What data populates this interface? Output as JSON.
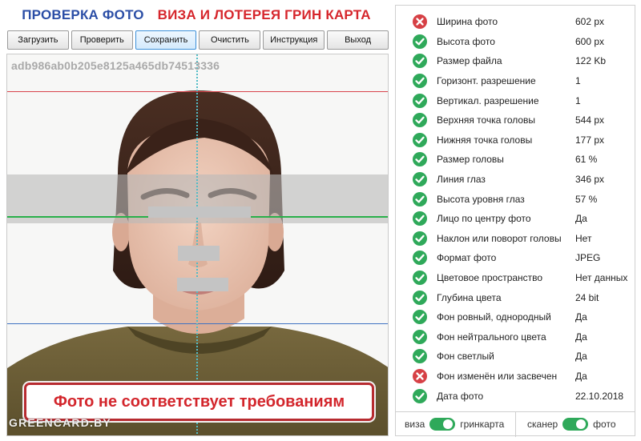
{
  "header": {
    "title_part1": "ПРОВЕРКА ФОТО",
    "title_part2": "ВИЗА И ЛОТЕРЕЯ ГРИН КАРТА"
  },
  "toolbar": {
    "buttons": [
      {
        "label": "Загрузить"
      },
      {
        "label": "Проверить"
      },
      {
        "label": "Сохранить"
      },
      {
        "label": "Очистить"
      },
      {
        "label": "Инструкция"
      },
      {
        "label": "Выход"
      }
    ]
  },
  "photo": {
    "hash": "adb986ab0b205e8125a465db74513336",
    "warning": "Фото не соответствует требованиям",
    "watermark": "GREENCARD.BY"
  },
  "checks": [
    {
      "label": "Ширина фото",
      "value": "602 px",
      "status": "fail"
    },
    {
      "label": "Высота фото",
      "value": "600 px",
      "status": "ok"
    },
    {
      "label": "Размер файла",
      "value": "122 Kb",
      "status": "ok"
    },
    {
      "label": "Горизонт. разрешение",
      "value": "1",
      "status": "ok"
    },
    {
      "label": "Вертикал. разрешение",
      "value": "1",
      "status": "ok"
    },
    {
      "label": "Верхняя точка головы",
      "value": "544 px",
      "status": "ok"
    },
    {
      "label": "Нижняя точка головы",
      "value": "177 px",
      "status": "ok"
    },
    {
      "label": "Размер головы",
      "value": "61 %",
      "status": "ok"
    },
    {
      "label": "Линия глаз",
      "value": "346 px",
      "status": "ok"
    },
    {
      "label": "Высота уровня глаз",
      "value": "57 %",
      "status": "ok"
    },
    {
      "label": "Лицо по центру фото",
      "value": "Да",
      "status": "ok"
    },
    {
      "label": "Наклон или поворот головы",
      "value": "Нет",
      "status": "ok"
    },
    {
      "label": "Формат фото",
      "value": "JPEG",
      "status": "ok"
    },
    {
      "label": "Цветовое пространство",
      "value": "Нет данных",
      "status": "ok"
    },
    {
      "label": "Глубина цвета",
      "value": "24 bit",
      "status": "ok"
    },
    {
      "label": "Фон ровный, однородный",
      "value": "Да",
      "status": "ok"
    },
    {
      "label": "Фон нейтрального цвета",
      "value": "Да",
      "status": "ok"
    },
    {
      "label": "Фон светлый",
      "value": "Да",
      "status": "ok"
    },
    {
      "label": "Фон изменён или засвечен",
      "value": "Да",
      "status": "fail"
    },
    {
      "label": "Дата фото",
      "value": "22.10.2018",
      "status": "ok"
    }
  ],
  "toggles": {
    "mode": {
      "left": "виза",
      "right": "гринкарта",
      "state": "right"
    },
    "source": {
      "left": "сканер",
      "right": "фото",
      "state": "right"
    }
  },
  "colors": {
    "ok": "#2fa95a",
    "fail": "#d64045",
    "title_blue": "#2b4ea6",
    "title_red": "#d6262c",
    "active_button": "#3c8fd8"
  }
}
